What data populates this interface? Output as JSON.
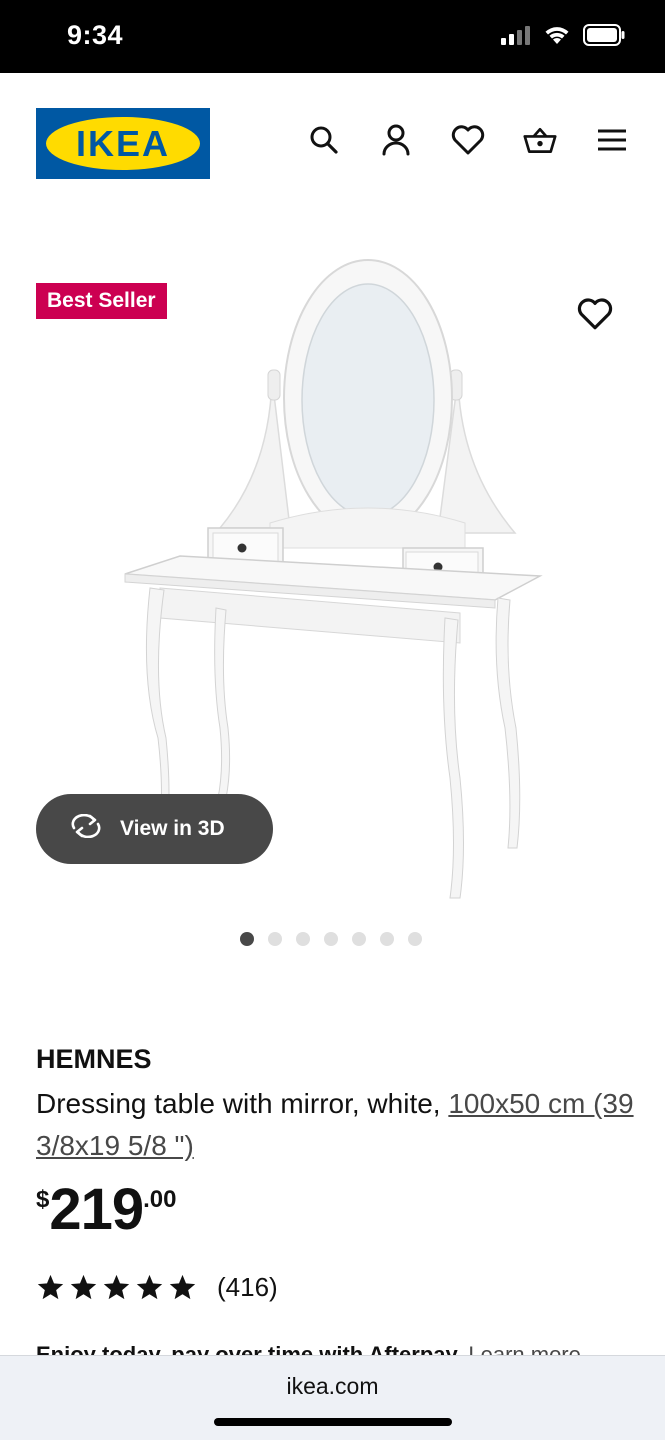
{
  "status_bar": {
    "time": "9:34",
    "icons": [
      "cellular-signal-icon",
      "wifi-icon",
      "battery-icon"
    ]
  },
  "header": {
    "logo_text": "IKEA",
    "icons": [
      "search-icon",
      "account-icon",
      "wishlist-heart-icon",
      "shopping-basket-icon",
      "menu-icon"
    ]
  },
  "product_media": {
    "badge": "Best Seller",
    "view_3d_label": "View in 3D",
    "image_count": 7,
    "active_image_index": 0
  },
  "product": {
    "name": "HEMNES",
    "description_prefix": "Dressing table with mirror, white, ",
    "dimensions": "100x50 cm (39 3/8x19 5/8 \")",
    "price_currency": "$",
    "price_int": "219",
    "price_dec": ".00",
    "rating_stars": 5,
    "review_count": "(416)"
  },
  "afterpay": {
    "text": "Enjoy today, pay over time with Afterpay. ",
    "link": "Learn more"
  },
  "browser": {
    "url": "ikea.com"
  },
  "colors": {
    "brand_blue": "#0058a3",
    "brand_yellow": "#ffdb00",
    "badge_red": "#cc0051",
    "button_dark": "#484848"
  }
}
